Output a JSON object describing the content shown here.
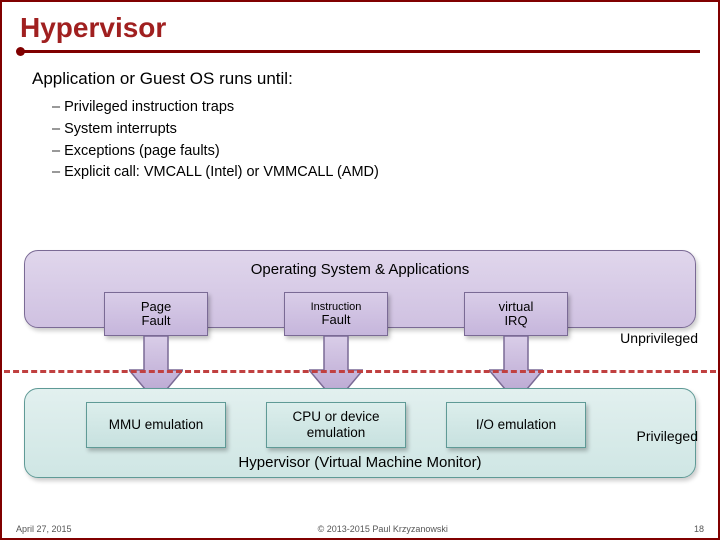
{
  "title": "Hypervisor",
  "lead": "Application or Guest OS runs until:",
  "bullets": [
    "Privileged instruction traps",
    "System interrupts",
    "Exceptions (page faults)",
    "Explicit call: VMCALL (Intel) or VMMCALL (AMD)"
  ],
  "diagram": {
    "os_label": "Operating System & Applications",
    "hypervisor_label": "Hypervisor (Virtual Machine Monitor)",
    "unprivileged_label": "Unprivileged",
    "privileged_label": "Privileged",
    "top_boxes": [
      {
        "line1": "Page",
        "line2": "Fault"
      },
      {
        "line1": "Instruction",
        "line2": "Fault"
      },
      {
        "line1": "virtual",
        "line2": "IRQ"
      }
    ],
    "bottom_boxes": [
      "MMU emulation",
      "CPU or device emulation",
      "I/O emulation"
    ]
  },
  "footer": {
    "date": "April 27, 2015",
    "copyright": "© 2013-2015 Paul Krzyzanowski",
    "page": "18"
  }
}
